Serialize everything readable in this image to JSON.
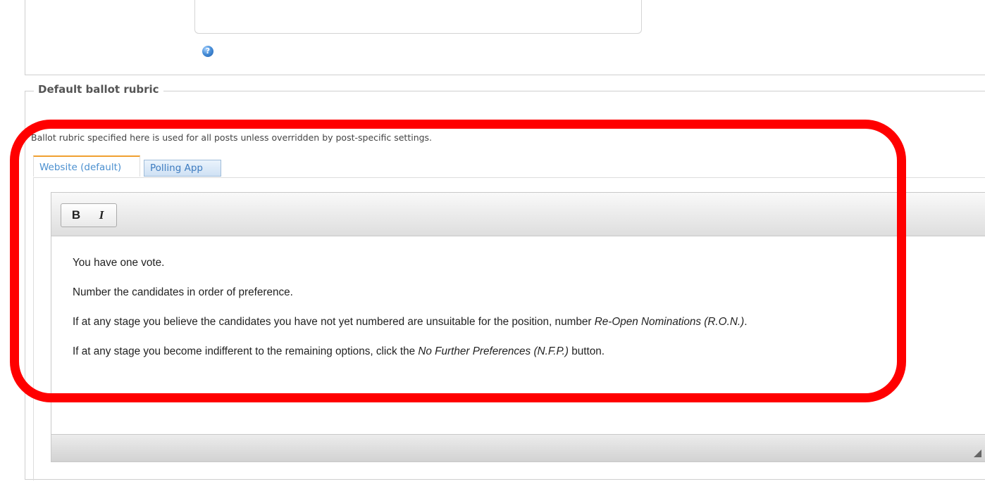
{
  "top_section": {
    "help_icon_glyph": "?"
  },
  "fieldset": {
    "legend": "Default ballot rubric",
    "description": "Ballot rubric specified here is used for all posts unless overridden by post-specific settings."
  },
  "tabs": [
    {
      "label": "Website (default)",
      "active": true
    },
    {
      "label": "Polling App",
      "active": false
    }
  ],
  "editor": {
    "toolbar": {
      "bold_label": "B",
      "italic_label": "I"
    },
    "paragraphs": {
      "p1": "You have one vote.",
      "p2": "Number the candidates in order of preference.",
      "p3_before": "If at any stage you believe the candidates you have not yet numbered are unsuitable for the position, number ",
      "p3_em": "Re-Open Nominations (R.O.N.)",
      "p3_after": ".",
      "p4_before": "If at any stage you become indifferent to the remaining options, click the ",
      "p4_em": "No Further Preferences (N.F.P.)",
      "p4_after": " button."
    }
  },
  "annotation": {
    "color": "#ff0000"
  }
}
